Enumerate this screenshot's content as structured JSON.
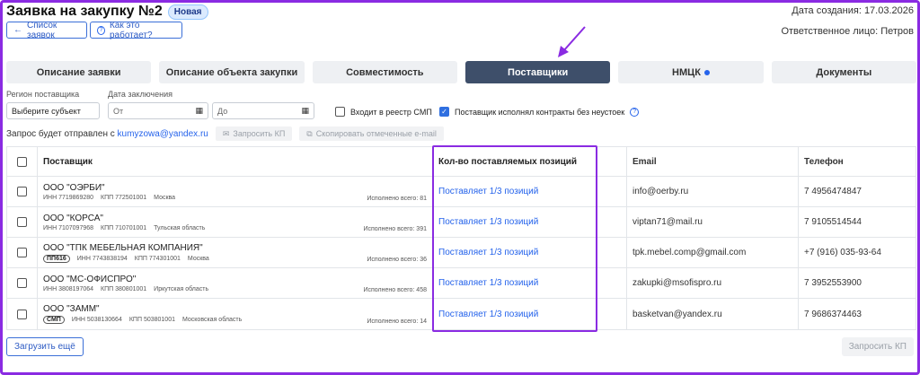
{
  "header": {
    "title": "Заявка на закупку №2",
    "status": "Новая",
    "created": "Дата создания: 17.03.2026",
    "responsible": "Ответственное лицо: Петров"
  },
  "nav": {
    "back_label": "Список заявок",
    "help_label": "Как это работает?"
  },
  "tabs": [
    {
      "label": "Описание заявки"
    },
    {
      "label": "Описание объекта закупки"
    },
    {
      "label": "Совместимость"
    },
    {
      "label": "Поставщики"
    },
    {
      "label": "НМЦК"
    },
    {
      "label": "Документы"
    }
  ],
  "filters": {
    "region_label": "Регион поставщика",
    "region_value": "Выберите субъект",
    "date_label": "Дата заключения",
    "date_from": "От",
    "date_to": "До",
    "smp_label": "Входит в реестр СМП",
    "smp_checked": false,
    "no_penalty_label": "Поставщик исполнял контракты без неустоек",
    "no_penalty_checked": true
  },
  "request": {
    "text": "Запрос будет отправлен с",
    "email": "kumyzowa@yandex.ru",
    "request_kp": "Запросить КП",
    "copy_email": "Скопировать отмеченные e-mail"
  },
  "table": {
    "headers": {
      "supplier": "Поставщик",
      "positions": "Кол-во поставляемых позиций",
      "email": "Email",
      "phone": "Телефон"
    },
    "rows": [
      {
        "name": "ООО \"ОЭРБИ\"",
        "tag": "",
        "inn": "ИНН 7719869280",
        "kpp": "КПП 772501001",
        "region": "Москва",
        "done": "Исполнено всего: 81",
        "positions": "Поставляет 1/3 позиций",
        "email": "info@oerby.ru",
        "phone": "7 4956474847"
      },
      {
        "name": "ООО \"КОРСА\"",
        "tag": "",
        "inn": "ИНН 7107097968",
        "kpp": "КПП 710701001",
        "region": "Тульская область",
        "done": "Исполнено всего: 391",
        "positions": "Поставляет 1/3 позиций",
        "email": "viptan71@mail.ru",
        "phone": "7 9105514544"
      },
      {
        "name": "ООО \"ТПК МЕБЕЛЬНАЯ КОМПАНИЯ\"",
        "tag": "ПП616",
        "inn": "ИНН 7743838194",
        "kpp": "КПП 774301001",
        "region": "Москва",
        "done": "Исполнено всего: 36",
        "positions": "Поставляет 1/3 позиций",
        "email": "tpk.mebel.comp@gmail.com",
        "phone": "+7 (916) 035-93-64"
      },
      {
        "name": "ООО \"МС-ОФИСПРО\"",
        "tag": "",
        "inn": "ИНН 3808197064",
        "kpp": "КПП 380801001",
        "region": "Иркутская область",
        "done": "Исполнено всего: 458",
        "positions": "Поставляет 1/3 позиций",
        "email": "zakupki@msofispro.ru",
        "phone": "7 3952553900"
      },
      {
        "name": "ООО \"ЗАММ\"",
        "tag": "СМП",
        "inn": "ИНН 5038130664",
        "kpp": "КПП 503801001",
        "region": "Московская область",
        "done": "Исполнено всего: 14",
        "positions": "Поставляет 1/3 позиций",
        "email": "basketvan@yandex.ru",
        "phone": "7 9686374463"
      }
    ]
  },
  "footer": {
    "load_more": "Загрузить ещё",
    "request_kp": "Запросить КП"
  },
  "colors": {
    "accent": "#2563eb",
    "highlight": "#8a2be2",
    "active_tab": "#3e4f6a"
  }
}
